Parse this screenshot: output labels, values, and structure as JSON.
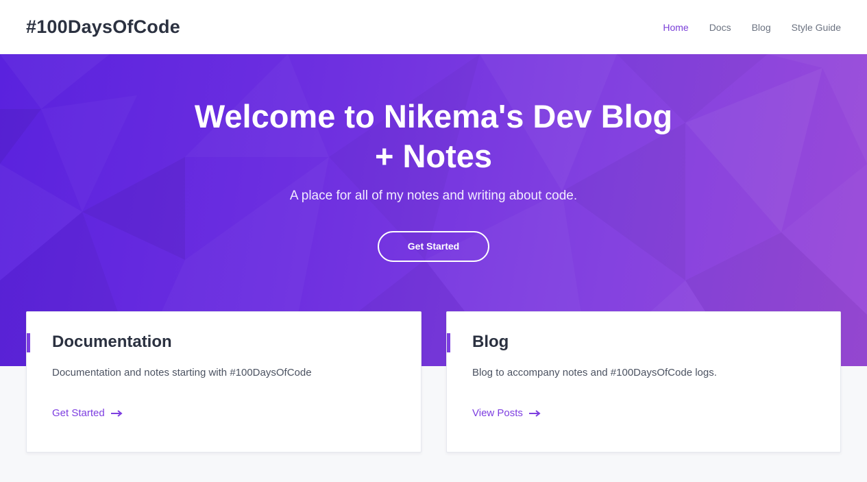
{
  "header": {
    "brand": "#100DaysOfCode",
    "nav": [
      {
        "label": "Home",
        "active": true
      },
      {
        "label": "Docs",
        "active": false
      },
      {
        "label": "Blog",
        "active": false
      },
      {
        "label": "Style Guide",
        "active": false
      }
    ]
  },
  "hero": {
    "title_line1": "Welcome to Nikema's Dev Blog",
    "title_line2": "+ Notes",
    "subtitle": "A place for all of my notes and writing about code.",
    "button_label": "Get Started"
  },
  "cards": [
    {
      "title": "Documentation",
      "description": "Documentation and notes starting with #100DaysOfCode",
      "link_label": "Get Started",
      "link_icon": "arrow-right-icon"
    },
    {
      "title": "Blog",
      "description": "Blog to accompany notes and #100DaysOfCode logs.",
      "link_label": "View Posts",
      "link_icon": "arrow-right-icon"
    }
  ],
  "colors": {
    "accent": "#7d3ee0",
    "hero_start": "#5a22de",
    "hero_end": "#9a4ad8",
    "text_dark": "#2b3140"
  }
}
